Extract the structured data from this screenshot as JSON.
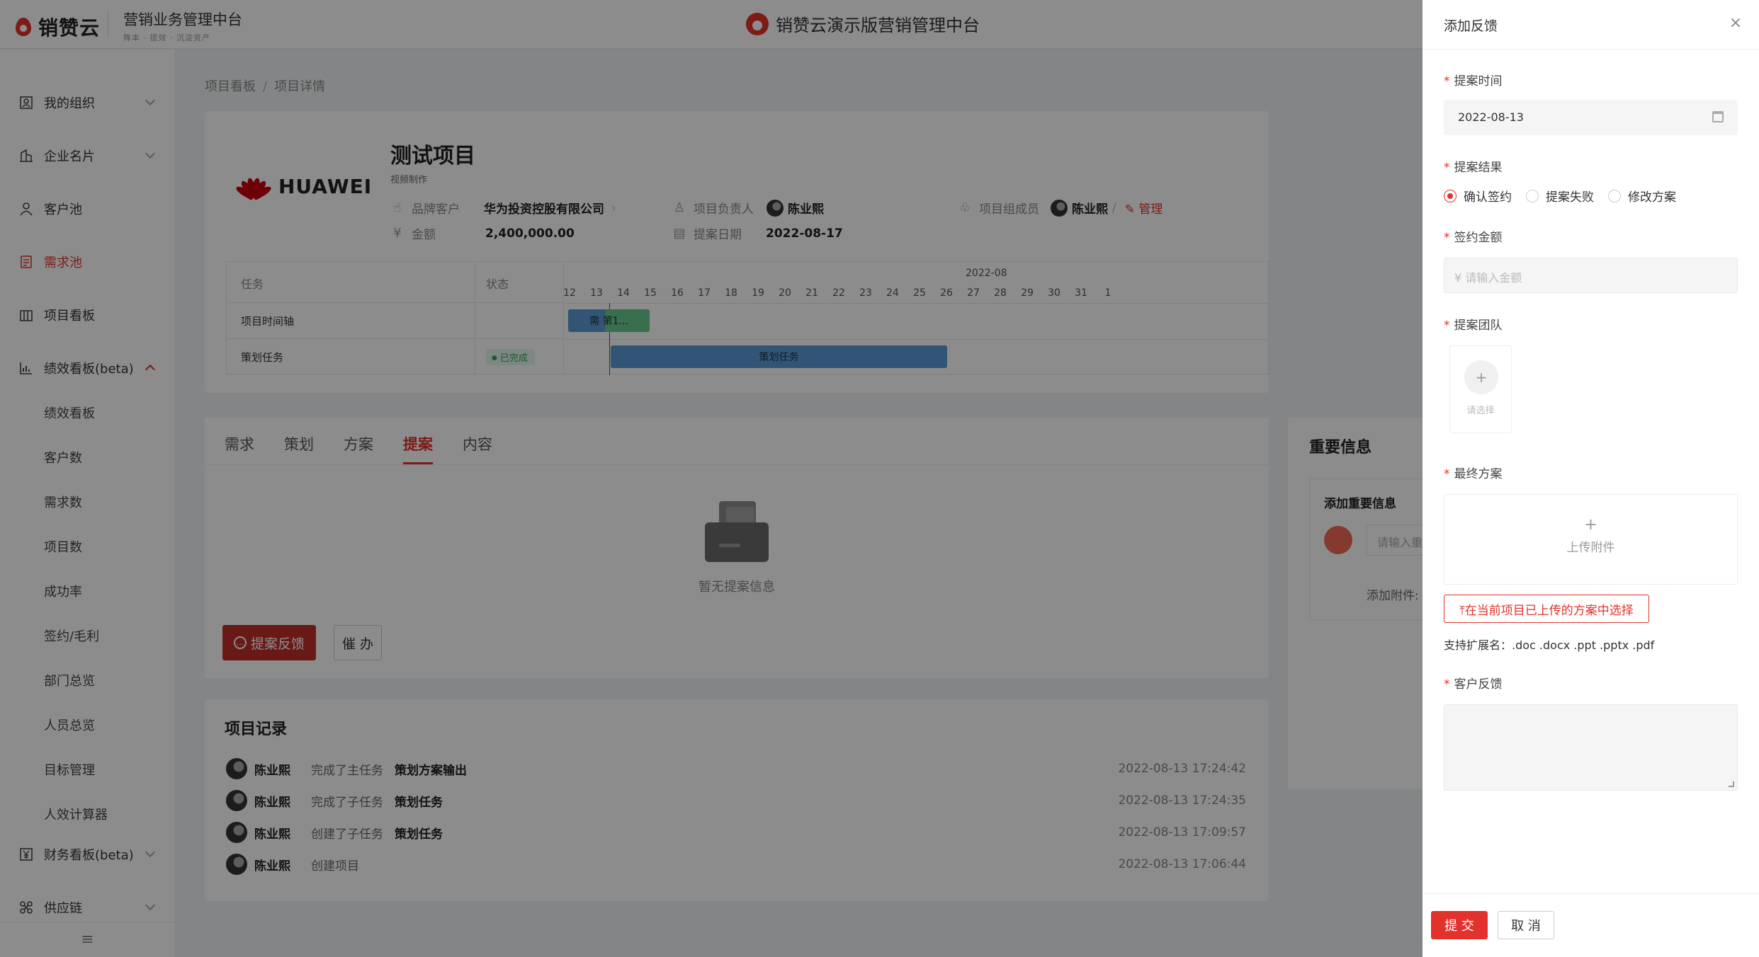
{
  "header": {
    "logo_text": "销赞云",
    "platform_title": "营销业务管理中台",
    "platform_slogan": "降本 · 提效 · 沉淀资产",
    "center_title": "销赞云演示版营销管理中台"
  },
  "sidebar": {
    "items": [
      {
        "label": "我的组织",
        "icon": "org-icon"
      },
      {
        "label": "企业名片",
        "icon": "building-icon"
      },
      {
        "label": "客户池",
        "icon": "user-icon"
      },
      {
        "label": "需求池",
        "icon": "doc-icon"
      },
      {
        "label": "项目看板",
        "icon": "board-icon"
      },
      {
        "label": "绩效看板(beta)",
        "icon": "chart-icon"
      },
      {
        "label": "财务看板(beta)",
        "icon": "yen-icon"
      },
      {
        "label": "供应链",
        "icon": "chain-icon"
      }
    ],
    "sub_items": [
      "绩效看板",
      "客户数",
      "需求数",
      "项目数",
      "成功率",
      "签约/毛利",
      "部门总览",
      "人员总览",
      "目标管理",
      "人效计算器"
    ],
    "collapse_icon": "≡"
  },
  "breadcrumb": {
    "first": "项目看板",
    "sep": "/",
    "second": "项目详情"
  },
  "project": {
    "brand_logo": "HUAWEI",
    "name": "测试项目",
    "subtitle": "视频制作",
    "brand_customer_label": "品牌客户",
    "brand_customer_value": "华为投资控股有限公司",
    "amount_label": "金额",
    "amount_value": "2,400,000.00",
    "owner_label": "项目负责人",
    "owner_value": "陈业熙",
    "date_label": "提案日期",
    "date_value": "2022-08-17",
    "members_label": "项目组成员",
    "members_value": "陈业熙",
    "members_sep": "/",
    "manage_label": "管理"
  },
  "gantt": {
    "col_task": "任务",
    "col_status": "状态",
    "month": "2022-08",
    "days": [
      "12",
      "13",
      "14",
      "15",
      "16",
      "17",
      "18",
      "19",
      "20",
      "21",
      "22",
      "23",
      "24",
      "25",
      "26",
      "27",
      "28",
      "29",
      "30",
      "31",
      "1"
    ],
    "rows": [
      {
        "task": "项目时间轴",
        "status": "",
        "bar_label": "需 第1..."
      },
      {
        "task": "策划任务",
        "status": "已完成",
        "bar_label": "策划任务"
      }
    ]
  },
  "tabs": {
    "items": [
      "需求",
      "策划",
      "方案",
      "提案",
      "内容"
    ],
    "active_index": 3,
    "empty_text": "暂无提案信息",
    "feedback_button": "提案反馈",
    "urge_button": "催 办"
  },
  "important": {
    "title": "重要信息",
    "box_title": "添加重要信息",
    "input_placeholder": "请输入重",
    "attach_label": "添加附件:"
  },
  "records": {
    "title": "项目记录",
    "items": [
      {
        "user": "陈业熙",
        "action": "完成了主任务",
        "target": "策划方案输出",
        "time": "2022-08-13 17:24:42"
      },
      {
        "user": "陈业熙",
        "action": "完成了子任务",
        "target": "策划任务",
        "time": "2022-08-13 17:24:35"
      },
      {
        "user": "陈业熙",
        "action": "创建了子任务",
        "target": "策划任务",
        "time": "2022-08-13 17:09:57"
      },
      {
        "user": "陈业熙",
        "action": "创建项目",
        "target": "",
        "time": "2022-08-13 17:06:44"
      }
    ]
  },
  "drawer": {
    "title": "添加反馈",
    "close": "×",
    "required_mark": "*",
    "proposal_time_label": "提案时间",
    "proposal_time_value": "2022-08-13",
    "result_label": "提案结果",
    "result_options": [
      "确认签约",
      "提案失败",
      "修改方案"
    ],
    "result_selected": 0,
    "amount_label": "签约金额",
    "amount_placeholder": "¥  请输入金额",
    "team_label": "提案团队",
    "team_add_icon": "+",
    "team_add_label": "请选择",
    "final_plan_label": "最终方案",
    "upload_icon": "+",
    "upload_label": "上传附件",
    "pick_button": "⤒在当前项目已上传的方案中选择",
    "ext_note": "支持扩展名：.doc .docx .ppt .pptx .pdf",
    "feedback_label": "客户反馈",
    "submit": "提 交",
    "cancel": "取 消"
  },
  "colors": {
    "accent": "#e3322b",
    "done_green": "#2ea25b",
    "bar_blue": "#5b9bd5",
    "bar_green": "#69c98f"
  }
}
